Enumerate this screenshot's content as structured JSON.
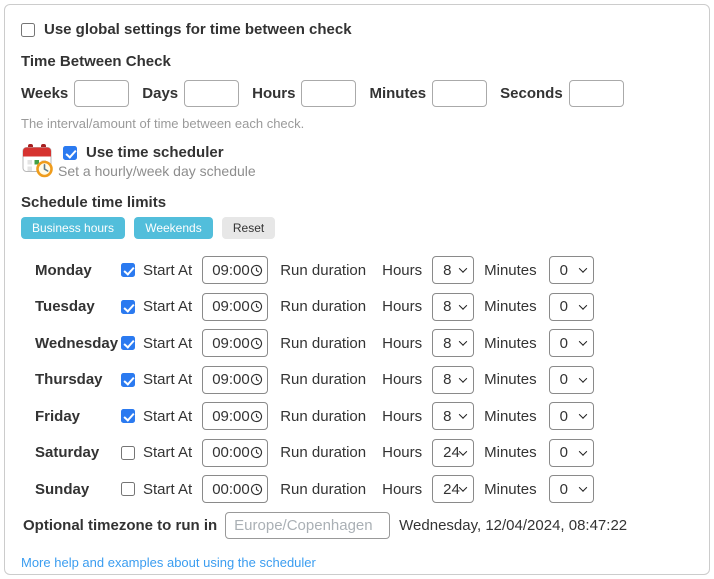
{
  "global": {
    "label": "Use global settings for time between check",
    "checked": false
  },
  "interval": {
    "heading": "Time Between Check",
    "fields": [
      {
        "label": "Weeks",
        "value": ""
      },
      {
        "label": "Days",
        "value": ""
      },
      {
        "label": "Hours",
        "value": ""
      },
      {
        "label": "Minutes",
        "value": ""
      },
      {
        "label": "Seconds",
        "value": ""
      }
    ],
    "help": "The interval/amount of time between each check."
  },
  "scheduler": {
    "icon": "calendar-clock-icon",
    "label": "Use time scheduler",
    "checked": true,
    "subtitle": "Set a hourly/week day schedule"
  },
  "limits": {
    "heading": "Schedule time limits",
    "preset_buttons": [
      {
        "label": "Business hours",
        "style": "info"
      },
      {
        "label": "Weekends",
        "style": "info"
      },
      {
        "label": "Reset",
        "style": "default"
      }
    ],
    "labels": {
      "start_at": "Start At",
      "run_duration": "Run duration",
      "hours": "Hours",
      "minutes": "Minutes"
    },
    "days": [
      {
        "name": "Monday",
        "enabled": true,
        "start_time": "09:00",
        "run_hours": "8",
        "run_minutes": "0"
      },
      {
        "name": "Tuesday",
        "enabled": true,
        "start_time": "09:00",
        "run_hours": "8",
        "run_minutes": "0"
      },
      {
        "name": "Wednesday",
        "enabled": true,
        "start_time": "09:00",
        "run_hours": "8",
        "run_minutes": "0"
      },
      {
        "name": "Thursday",
        "enabled": true,
        "start_time": "09:00",
        "run_hours": "8",
        "run_minutes": "0"
      },
      {
        "name": "Friday",
        "enabled": true,
        "start_time": "09:00",
        "run_hours": "8",
        "run_minutes": "0"
      },
      {
        "name": "Saturday",
        "enabled": false,
        "start_time": "00:00",
        "run_hours": "24",
        "run_minutes": "0"
      },
      {
        "name": "Sunday",
        "enabled": false,
        "start_time": "00:00",
        "run_hours": "24",
        "run_minutes": "0"
      }
    ]
  },
  "timezone": {
    "label": "Optional timezone to run in",
    "placeholder": "Europe/Copenhagen",
    "value": "",
    "current_datetime": "Wednesday, 12/04/2024, 08:47:22"
  },
  "help_link": {
    "text": "More help and examples about using the scheduler"
  },
  "colors": {
    "info_button": "#52bedb",
    "checkbox_checked": "#2b7af0",
    "link": "#3b9df0"
  }
}
